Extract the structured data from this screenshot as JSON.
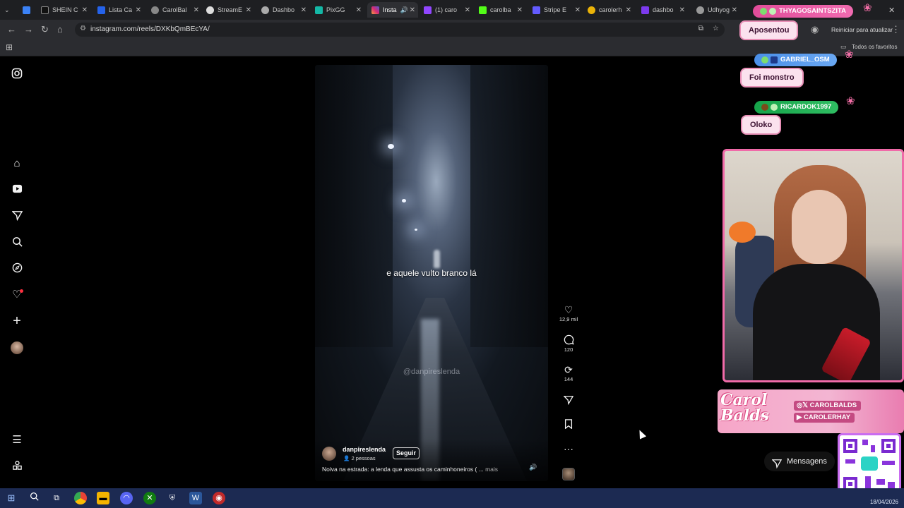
{
  "browser": {
    "tabs": [
      {
        "label": "",
        "icon": "chevron-down-icon"
      },
      {
        "label": "",
        "icon": "gem-icon"
      },
      {
        "label": "SHEIN C",
        "icon": "shein-icon"
      },
      {
        "label": "Lista Ca",
        "icon": "cloud-icon"
      },
      {
        "label": "CarolBal",
        "icon": "globe-icon"
      },
      {
        "label": "StreamE",
        "icon": "streamelements-icon"
      },
      {
        "label": "Dashbo",
        "icon": "globe-icon"
      },
      {
        "label": "PixGG",
        "icon": "pixgg-icon"
      },
      {
        "label": "Insta",
        "icon": "instagram-icon"
      },
      {
        "label": "(1) caro",
        "icon": "twitch-icon"
      },
      {
        "label": "carolba",
        "icon": "kick-icon"
      },
      {
        "label": "Stripe E",
        "icon": "stripe-icon"
      },
      {
        "label": "carolerh",
        "icon": "eye-icon"
      },
      {
        "label": "dashbo",
        "icon": "dashboard-icon"
      },
      {
        "label": "Udhyog",
        "icon": "globe-icon"
      }
    ],
    "url": "instagram.com/reels/DXKbQmBEcYA/",
    "update_button": "Reiniciar para atualizar",
    "all_bookmarks": "Todos os favoritos"
  },
  "reel": {
    "subtitle": "e aquele vulto branco lá",
    "watermark": "@danpireslenda",
    "username": "danpireslenda",
    "people": "2 pessoas",
    "follow_label": "Seguir",
    "caption": "Noiva na estrada: a lenda que assusta os caminhoneiros ( ...",
    "more_label": "mais",
    "actions": {
      "likes": "12,9 mil",
      "comments": "120",
      "reposts": "144"
    }
  },
  "sidebar_icons": [
    "instagram-icon",
    "home-icon",
    "reels-icon",
    "send-icon",
    "search-icon",
    "explore-icon",
    "heart-icon",
    "plus-icon",
    "profile-icon",
    "menu-icon",
    "apps-icon"
  ],
  "chat": [
    {
      "user": "THYAGOSAINTSZITA",
      "message": "Aposentou",
      "color": "#e24c9a"
    },
    {
      "user": "GABRIEL_OSM",
      "message": "Foi monstro",
      "color": "#4a8fe8"
    },
    {
      "user": "RICARDOK1997",
      "message": "Oloko",
      "color": "#16a34a"
    }
  ],
  "branding": {
    "logo": "Carol Balds",
    "social_1": "CAROLBALDS",
    "social_2": "CAROLERHAY"
  },
  "messages_button": "Mensagens",
  "taskbar": {
    "date": "18/04/2026"
  }
}
